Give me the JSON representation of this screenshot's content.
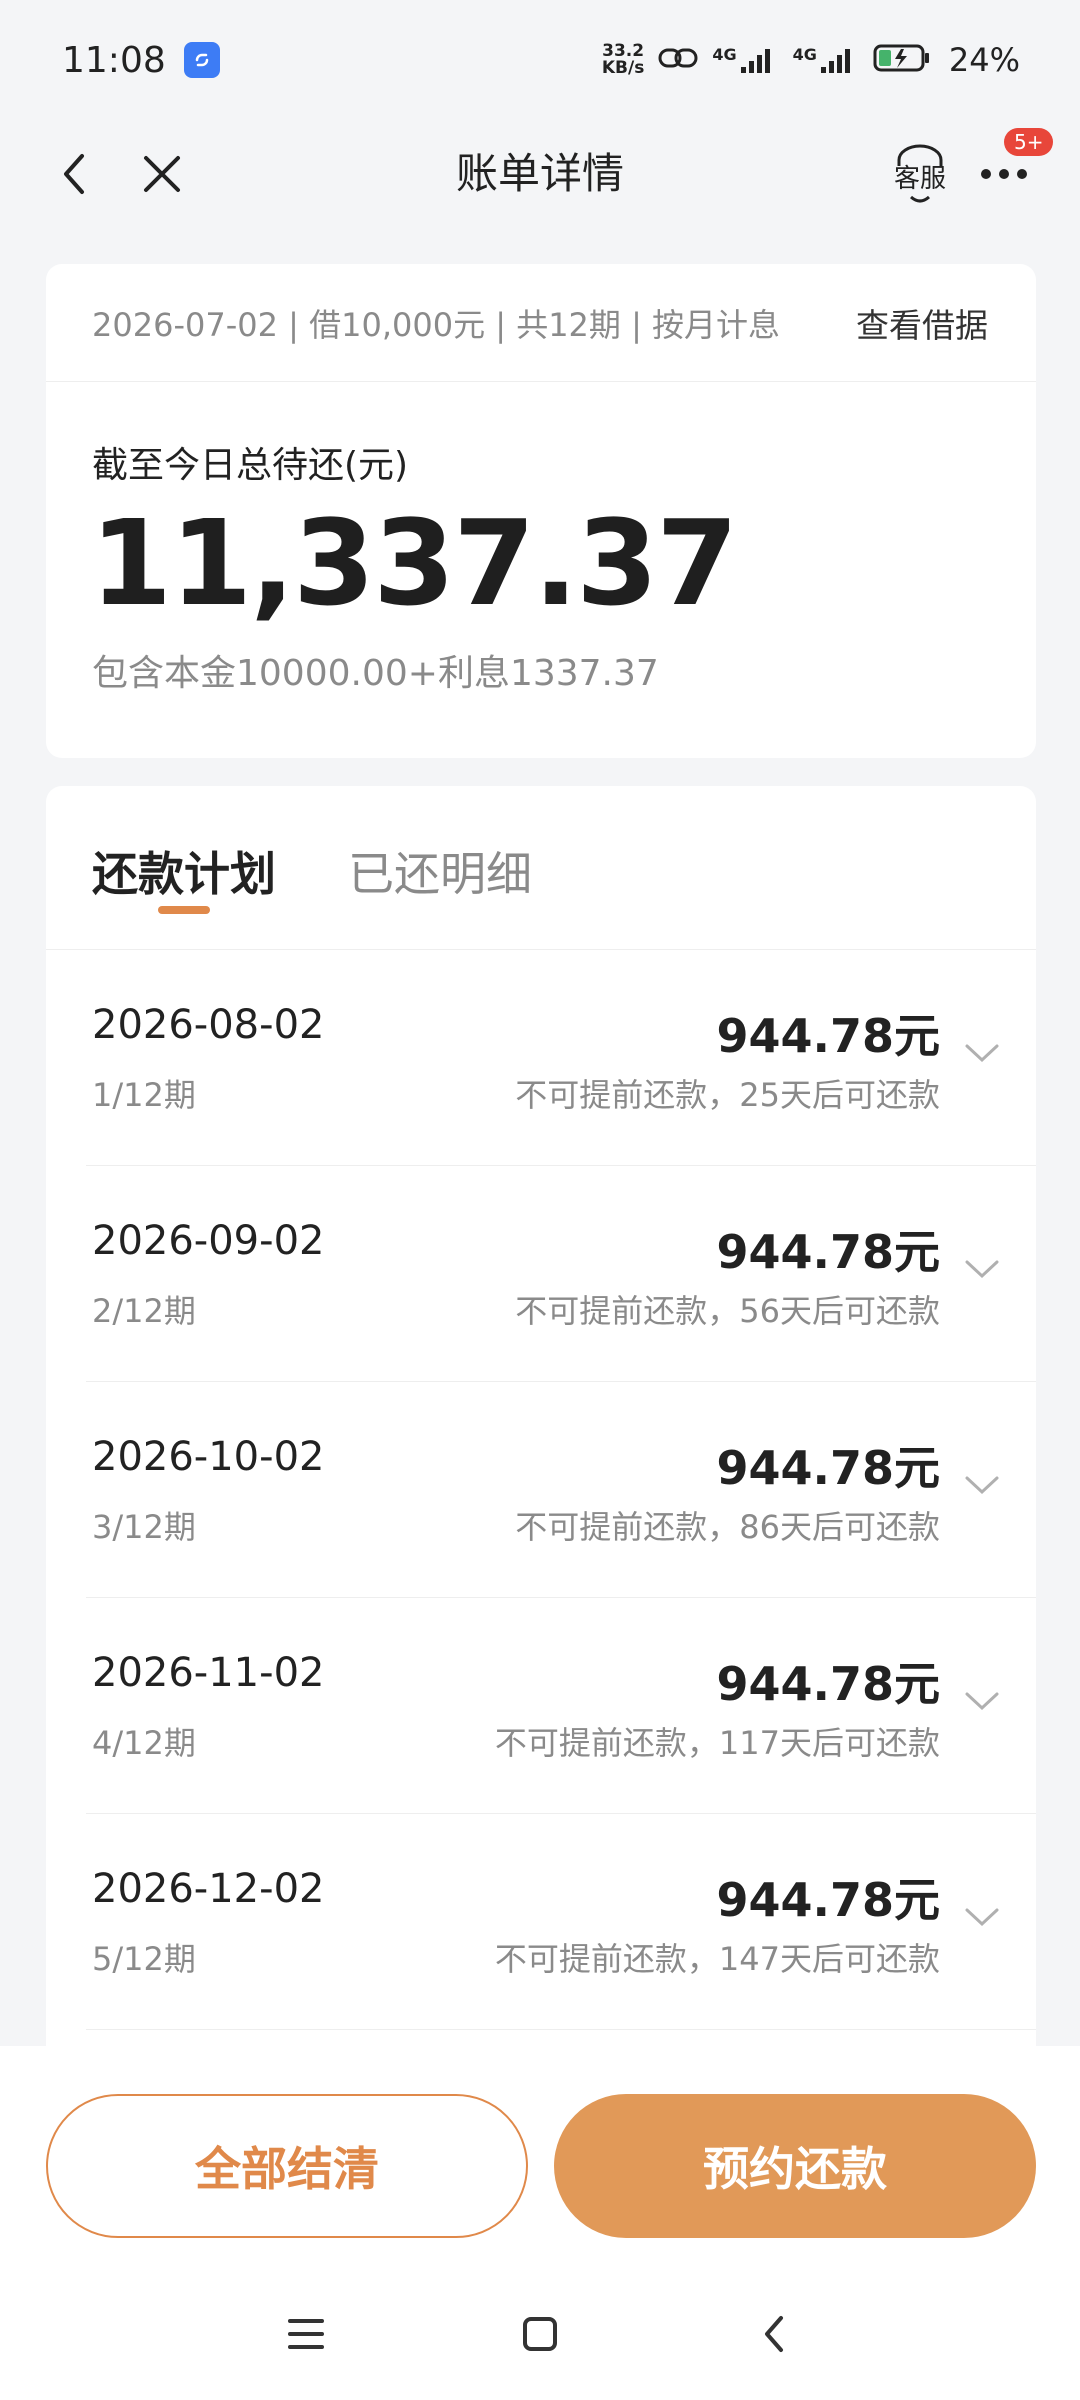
{
  "status_bar": {
    "time": "11:08",
    "net_speed_value": "33.2",
    "net_speed_unit": "KB/s",
    "signal_1_label": "4G",
    "signal_2_label": "4G",
    "battery_percent": "24%"
  },
  "header": {
    "title": "账单详情",
    "customer_service_label": "客服",
    "notification_badge": "5+"
  },
  "summary": {
    "loan_info": "2026-07-02 | 借10,000元 | 共12期 | 按月计息",
    "view_contract": "查看借据",
    "total_label": "截至今日总待还(元)",
    "total_amount": "11,337.37",
    "breakdown": "包含本金10000.00+利息1337.37"
  },
  "tabs": [
    {
      "label": "还款计划",
      "active": true
    },
    {
      "label": "已还明细",
      "active": false
    }
  ],
  "plan": [
    {
      "date": "2026-08-02",
      "period": "1/12期",
      "amount": "944.78元",
      "note": "不可提前还款，25天后可还款"
    },
    {
      "date": "2026-09-02",
      "period": "2/12期",
      "amount": "944.78元",
      "note": "不可提前还款，56天后可还款"
    },
    {
      "date": "2026-10-02",
      "period": "3/12期",
      "amount": "944.78元",
      "note": "不可提前还款，86天后可还款"
    },
    {
      "date": "2026-11-02",
      "period": "4/12期",
      "amount": "944.78元",
      "note": "不可提前还款，117天后可还款"
    },
    {
      "date": "2026-12-02",
      "period": "5/12期",
      "amount": "944.78元",
      "note": "不可提前还款，147天后可还款"
    }
  ],
  "actions": {
    "settle_all": "全部结清",
    "book_repayment": "预约还款"
  },
  "colors": {
    "accent": "#e0894a",
    "primary_button": "#e19958",
    "badge": "#e8463a"
  }
}
